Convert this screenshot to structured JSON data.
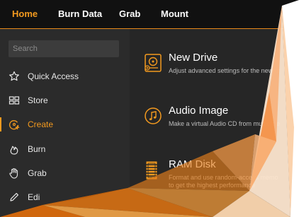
{
  "menu": {
    "tabs": [
      {
        "label": "Home",
        "active": true
      },
      {
        "label": "Burn Data"
      },
      {
        "label": "Grab"
      },
      {
        "label": "Mount"
      }
    ]
  },
  "sidebar": {
    "search_placeholder": "Search",
    "items": [
      {
        "label": "Quick Access",
        "icon": "star-icon"
      },
      {
        "label": "Store",
        "icon": "grid-icon"
      },
      {
        "label": "Create",
        "icon": "create-disc-icon",
        "active": true
      },
      {
        "label": "Burn",
        "icon": "flame-icon"
      },
      {
        "label": "Grab",
        "icon": "hand-icon"
      },
      {
        "label": "Edi",
        "icon": "pencil-icon"
      }
    ]
  },
  "main": {
    "cards": [
      {
        "title": "New Drive",
        "desc": "Adjust advanced settings for the new dr",
        "icon": "drive-icon"
      },
      {
        "title": "Audio Image",
        "desc": "Make a virtual Audio CD from music file",
        "icon": "music-note-icon"
      },
      {
        "title": "RAM Disk",
        "desc": "Format and use random-access memo",
        "desc2": "to get the highest performance",
        "icon": "ram-chip-icon"
      }
    ]
  },
  "colors": {
    "accent": "#f39a1f",
    "topbar": "#111111",
    "sidebar": "#2b2b2b",
    "content": "#262626"
  }
}
